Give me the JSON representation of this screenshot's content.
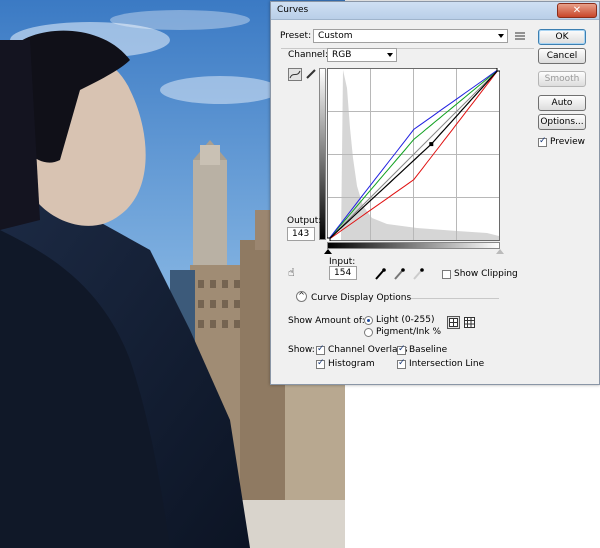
{
  "dialog": {
    "title": "Curves",
    "preset_label": "Preset:",
    "preset_value": "Custom",
    "preset_menu_icon": "list-menu-icon",
    "channel_label": "Channel:",
    "channel_value": "RGB",
    "output_label": "Output:",
    "output_value": "143",
    "input_label": "Input:",
    "input_value": "154",
    "show_clipping_label": "Show Clipping",
    "curve_display_options_label": "Curve Display Options",
    "show_amount_label": "Show Amount of:",
    "light_label": "Light  (0-255)",
    "pigment_label": "Pigment/Ink %",
    "show_label": "Show:",
    "channel_overlays_label": "Channel Overlays",
    "baseline_label": "Baseline",
    "histogram_label": "Histogram",
    "intersection_line_label": "Intersection Line",
    "buttons": {
      "ok": "OK",
      "cancel": "Cancel",
      "smooth": "Smooth",
      "auto": "Auto",
      "options": "Options..."
    },
    "preview_label": "Preview",
    "states": {
      "preview_checked": true,
      "show_clipping_checked": false,
      "light_selected": true,
      "pigment_selected": false,
      "channel_overlays_checked": true,
      "baseline_checked": true,
      "histogram_checked": true,
      "intersection_line_checked": true
    },
    "colors": {
      "curve_composite": "#000000",
      "curve_red": "#e01010",
      "curve_green": "#10a020",
      "curve_blue": "#2020e0",
      "accent": "#3c7fb1"
    }
  },
  "chart_data": {
    "type": "line",
    "xlim": [
      0,
      255
    ],
    "ylim": [
      0,
      255
    ],
    "grid": true,
    "series": [
      {
        "name": "RGB",
        "x": [
          0,
          154,
          255
        ],
        "y": [
          0,
          143,
          255
        ]
      },
      {
        "name": "Red",
        "x": [
          0,
          128,
          255
        ],
        "y": [
          0,
          90,
          255
        ]
      },
      {
        "name": "Green",
        "x": [
          0,
          128,
          255
        ],
        "y": [
          0,
          150,
          255
        ]
      },
      {
        "name": "Blue",
        "x": [
          0,
          128,
          255
        ],
        "y": [
          0,
          165,
          255
        ]
      }
    ]
  }
}
